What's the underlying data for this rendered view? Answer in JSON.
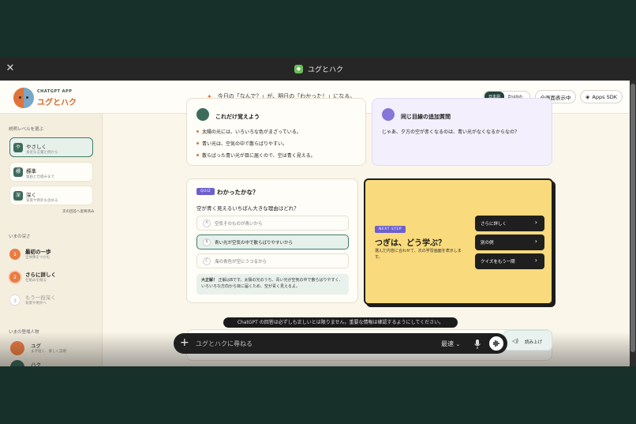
{
  "window": {
    "title": "ユグとハク",
    "app_icon": "app-icon"
  },
  "header": {
    "brand_small": "CHATGPT APP",
    "brand_name": "ユグとハク",
    "tagline": "今日の「なんで？」が、明日の「わかった！」になる。",
    "lang_options": [
      "日本語",
      "English"
    ],
    "selected_lang": "日本語",
    "fullscreen_label": "全画面表示中",
    "sdk_label": "Apps SDK"
  },
  "sidebar": {
    "level_section": "説明レベルを選ぶ",
    "levels": [
      {
        "icon": "や",
        "title": "やさしく",
        "desc": "身近な言葉と例から"
      },
      {
        "icon": "標",
        "title": "標準",
        "desc": "理由と仕組みまで"
      },
      {
        "icon": "深",
        "title": "深く",
        "desc": "背景や例外も含める"
      }
    ],
    "selected_level": "やさしく",
    "next_note": "次の回答へ反映済み",
    "depth_section": "いまの深さ",
    "steps": [
      {
        "num": "1",
        "title": "最初の一歩",
        "desc": "全体像をつかむ",
        "state": "done"
      },
      {
        "num": "2",
        "title": "さらに詳しく",
        "desc": "仕組みを掘る",
        "state": "current"
      },
      {
        "num": "3",
        "title": "もう一段深く",
        "desc": "背景や例外へ",
        "state": "todo"
      }
    ],
    "characters_section": "いまの登場人物",
    "characters": [
      {
        "name": "ユグ",
        "desc": "まず短く、楽しく説明"
      },
      {
        "name": "ハク",
        "desc": ""
      }
    ]
  },
  "summary_card": {
    "title": "これだけ覚えよう",
    "points": [
      "太陽の光には、いろいろな色がまざっている。",
      "青い光は、空気の中で散らばりやすい。",
      "散らばった青い光が目に届くので、空は青く見える。"
    ]
  },
  "followup_card": {
    "title": "同じ目線の追加質問",
    "question": "じゃあ、夕方の空が赤くなるのは、青い光がなくなるからなの？"
  },
  "quiz": {
    "tag": "QUIZ",
    "title": "わかったかな？",
    "question": "空が青く見えるいちばん大きな理由はどれ？",
    "options": [
      {
        "key": "A",
        "text": "空気そのものが青いから"
      },
      {
        "key": "B",
        "text": "青い光が空気の中で散らばりやすいから"
      },
      {
        "key": "C",
        "text": "海の青色が空にうつるから"
      }
    ],
    "selected": "B",
    "answer_label": "大正解！",
    "answer_text": "正解はBです。太陽の光のうち、青い光が空気の中で散らばりやすく、いろいろな方向から目に届くため、空が青く見えるよ。"
  },
  "next_step": {
    "tag": "NEXT STEP",
    "title": "つぎは、どう学ぶ？",
    "desc": "選んだ内容に合わせて、次の学習画面を表示します。",
    "buttons": [
      "さらに詳しく",
      "別の例",
      "クイズをもう一問"
    ]
  },
  "read_aloud_label": "読み上げ",
  "composer": {
    "placeholder": "ユグとハクに尋ねる",
    "model": "最速",
    "disclaimer": "ChatGPT の回答は必ずしも正しいとは限りません。重要な情報は確認するようにしてください。"
  },
  "colors": {
    "accent_orange": "#e0733c",
    "accent_green": "#3d6b5c",
    "quiz_purple": "#6d5fce",
    "next_card_yellow": "#f9da7c"
  }
}
